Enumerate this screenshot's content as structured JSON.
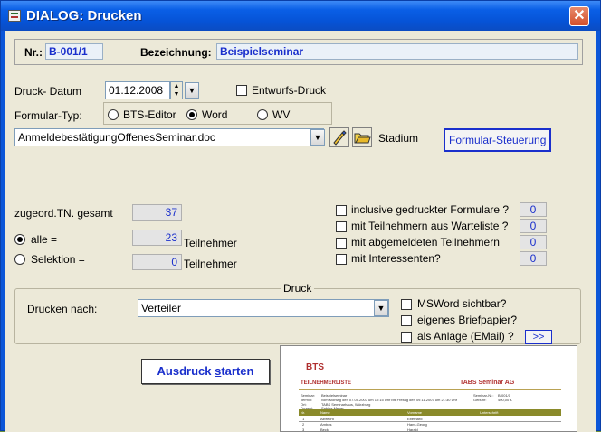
{
  "window": {
    "title": "DIALOG: Drucken",
    "close_glyph": "✕"
  },
  "header": {
    "nr_label": "Nr.:",
    "nr_value": "B-001/1",
    "bez_label": "Bezeichnung:",
    "bez_value": "Beispielseminar"
  },
  "form": {
    "date_label": "Druck- Datum",
    "date_value": "01.12.2008",
    "draft_label": "Entwurfs-Druck",
    "type_label": "Formular-Typ:",
    "types": [
      {
        "label": "BTS-Editor",
        "selected": false
      },
      {
        "label": "Word",
        "selected": true
      },
      {
        "label": "WV",
        "selected": false
      }
    ],
    "file_value": "AnmeldebestätigungOffenesSeminar.doc",
    "stadium_label": "Stadium",
    "steuerung_label": "Formular-Steuerung"
  },
  "participants": {
    "total_label": "zugeord.TN. gesamt",
    "total_value": "37",
    "all_label": "alle =",
    "all_value": "23",
    "sel_label": "Selektion =",
    "sel_value": "0",
    "unit_label": "Teilnehmer",
    "all_selected": true
  },
  "options": [
    {
      "label": "inclusive gedruckter Formulare ?",
      "value": "0"
    },
    {
      "label": "mit Teilnehmern aus Warteliste ?",
      "value": "0"
    },
    {
      "label": "mit abgemeldeten Teilnehmern",
      "value": "0"
    },
    {
      "label": "mit Interessenten?",
      "value": "0"
    }
  ],
  "print_group": {
    "title": "Druck",
    "drucken_nach_label": "Drucken nach:",
    "drucken_nach_value": "Verteiler",
    "msword_label": "MSWord sichtbar?",
    "briefpapier_label": "eigenes Briefpapier?",
    "anlage_label": "als Anlage (EMail) ?",
    "more_label": ">>"
  },
  "print_button": {
    "label_pre": "Ausdruck ",
    "label_ul": "s",
    "label_post": "tarten"
  },
  "preview": {
    "logo": "BTS",
    "doc_title": "TEILNEHMERLISTE",
    "company": "TABS Seminar AG",
    "seminar_label": "Seminar:",
    "seminar_value": "Beispielseminar",
    "termin_label": "Termin:",
    "termin_value": "vom Montag den 07.05.2007 um 10:15 Uhr bis Freitag den 09.11.2007 um 21:30 Uhr",
    "ort_label": "Ort:",
    "ort_value": "TABS Seminarhaus, Würzburg",
    "dozent_label": "Dozent:",
    "dozent_value": "Sabine Meyer",
    "semnr_label": "Seminar-Nr.:",
    "semnr_value": "B-001/1",
    "gebuehr_label": "Gebühr:",
    "gebuehr_value": "400,00 €",
    "table_headers": [
      "Nr.",
      "Name",
      "Vorname",
      "Unterschrift"
    ],
    "rows": [
      {
        "nr": "1",
        "name": "Albrecht",
        "vorname": "Eberhard"
      },
      {
        "nr": "2",
        "name": "Ambos",
        "vorname": "Hans-Georg"
      },
      {
        "nr": "3",
        "name": "Beck",
        "vorname": "Harald"
      }
    ]
  }
}
